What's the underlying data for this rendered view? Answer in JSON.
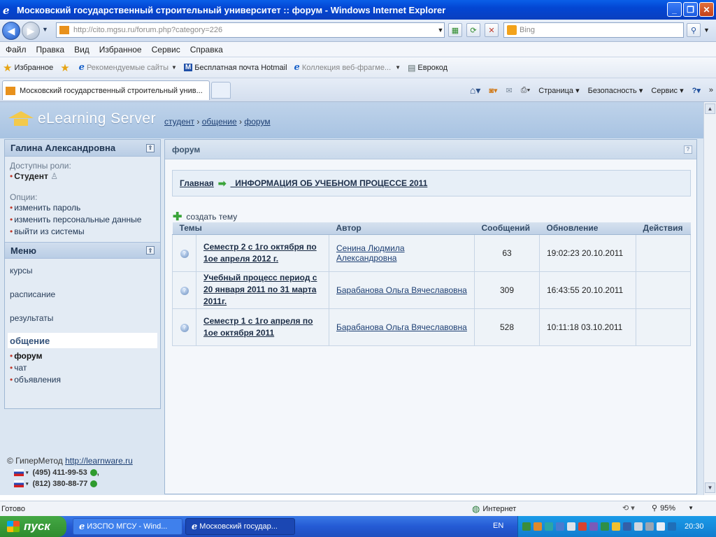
{
  "window": {
    "title": "Московский государственный строительный университет :: форум - Windows Internet Explorer"
  },
  "address_bar": {
    "url": "http://cito.mgsu.ru/forum.php?category=226",
    "search_placeholder": "Bing"
  },
  "menu_bar": [
    "Файл",
    "Правка",
    "Вид",
    "Избранное",
    "Сервис",
    "Справка"
  ],
  "favorites_bar": {
    "favorites_label": "Избранное",
    "items": [
      "Рекомендуемые сайты",
      "Бесплатная почта Hotmail",
      "Коллекция веб-фрагме...",
      "Еврокод"
    ]
  },
  "tabs": {
    "active_title": "Московский государственный строительный унив..."
  },
  "command_bar": [
    "Страница",
    "Безопасность",
    "Сервис"
  ],
  "site": {
    "logo_text": "eLearning Server",
    "breadcrumb": [
      "студент",
      "общение",
      "форум"
    ]
  },
  "user_panel": {
    "name": "Галина  Александровна",
    "roles_label": "Доступны роли:",
    "role": "Студент",
    "options_label": "Опции:",
    "options": [
      "изменить пароль",
      "изменить персональные данные",
      "выйти из системы"
    ]
  },
  "menu_panel": {
    "title": "Меню",
    "items": [
      "курсы",
      "расписание",
      "результаты"
    ],
    "active_section": "общение",
    "subitems": [
      "форум",
      "чат",
      "объявления"
    ]
  },
  "footer": {
    "copyright": "© ГиперМетод",
    "link": "http://learnware.ru",
    "phones": [
      "(495) 411-99-53",
      "(812) 380-88-77"
    ]
  },
  "forum": {
    "panel_title": "форум",
    "home_link": "Главная",
    "category_link": "_ИНФОРМАЦИЯ ОБ УЧЕБНОМ ПРОЦЕССЕ 2011",
    "create_topic": "создать тему",
    "columns": [
      "Темы",
      "Автор",
      "Сообщений",
      "Обновление",
      "Действия"
    ],
    "rows": [
      {
        "topic": "Семестр 2 с 1го октября по 1ое апреля 2012 г.",
        "author": "Сенина Людмила Александровна",
        "messages": "63",
        "updated": "19:02:23 20.10.2011",
        "actions": ""
      },
      {
        "topic": "Учебный процесс период с 20 января 2011 по 31 марта 2011г.",
        "author": "Барабанова Ольга Вячеславовна",
        "messages": "309",
        "updated": "16:43:55 20.10.2011",
        "actions": ""
      },
      {
        "topic": "Семестр 1 с 1го апреля по 1ое октября 2011",
        "author": "Барабанова Ольга Вячеславовна",
        "messages": "528",
        "updated": "10:11:18 03.10.2011",
        "actions": ""
      }
    ]
  },
  "status_bar": {
    "status": "Готово",
    "zone": "Интернет",
    "zoom": "95%"
  },
  "taskbar": {
    "start": "пуск",
    "tasks": [
      "ИЗСПО МГСУ - Wind...",
      "Московский государ..."
    ],
    "lang": "EN",
    "clock": "20:30"
  }
}
